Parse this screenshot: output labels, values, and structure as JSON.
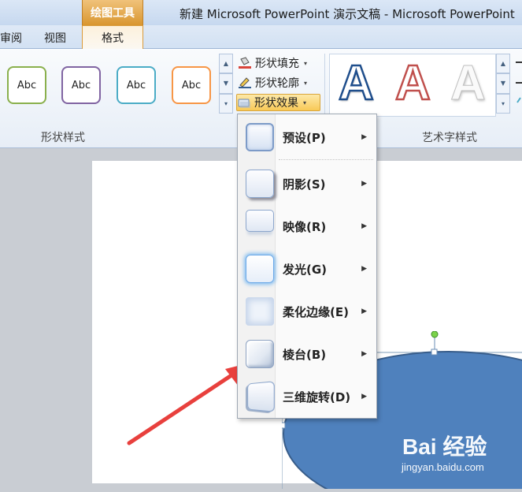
{
  "titlebar": {
    "context_tab": "绘图工具",
    "window_title": "新建 Microsoft PowerPoint 演示文稿 - Microsoft PowerPoint"
  },
  "tabs": {
    "review": "审阅",
    "view": "视图",
    "format": "格式"
  },
  "ribbon": {
    "shape_styles": [
      {
        "label": "Abc",
        "color": "#8ab04d"
      },
      {
        "label": "Abc",
        "color": "#8064a2"
      },
      {
        "label": "Abc",
        "color": "#4bacc6"
      },
      {
        "label": "Abc",
        "color": "#f79646"
      }
    ],
    "shape_fill": "形状填充",
    "shape_outline": "形状轮廓",
    "shape_effects": "形状效果",
    "group_shape_styles": "形状样式",
    "group_wordart_styles": "艺术字样式",
    "wordart": [
      {
        "label": "A",
        "style": "blue-outline"
      },
      {
        "label": "A",
        "style": "red-outline"
      },
      {
        "label": "A",
        "style": "white-gray"
      }
    ]
  },
  "effects_menu": {
    "items": [
      {
        "label": "预设(P)",
        "icon": "preset-icon"
      },
      {
        "label": "阴影(S)",
        "icon": "shadow-icon"
      },
      {
        "label": "映像(R)",
        "icon": "reflection-icon"
      },
      {
        "label": "发光(G)",
        "icon": "glow-icon"
      },
      {
        "label": "柔化边缘(E)",
        "icon": "soft-edges-icon"
      },
      {
        "label": "棱台(B)",
        "icon": "bevel-icon"
      },
      {
        "label": "三维旋转(D)",
        "icon": "3d-rotation-icon"
      }
    ]
  },
  "colors": {
    "shape_fill": "#4f81bd",
    "arrow": "#e8403d",
    "accent_active": "#f8c957"
  },
  "watermark": {
    "brand": "Bai 经验",
    "site": "jingyan.baidu.com"
  }
}
